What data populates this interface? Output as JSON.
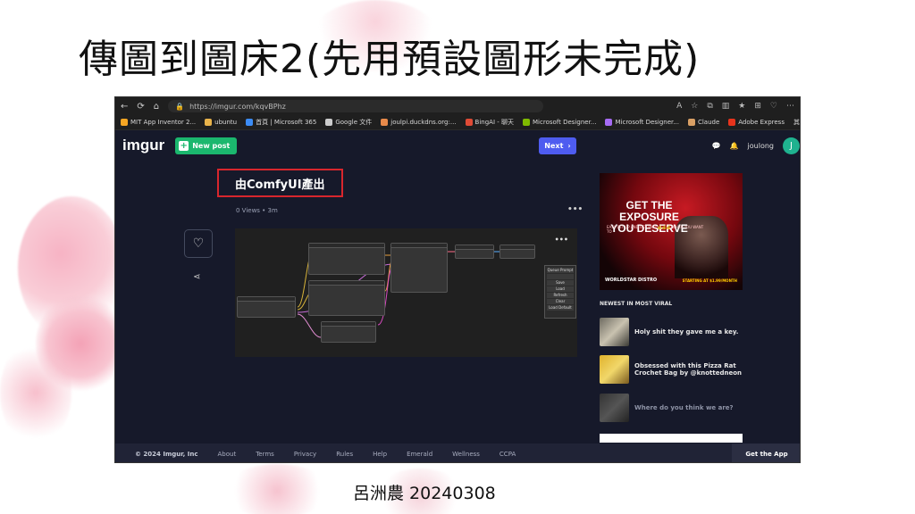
{
  "slide": {
    "title": "傳圖到圖床2(先用預設圖形未完成)",
    "author": "呂洲農 20240308"
  },
  "browser": {
    "url": "https://imgur.com/kqvBPhz",
    "bookmarks": [
      {
        "label": "MIT App Inventor 2...",
        "icon": "app-inventor-icon",
        "color": "#f6a623"
      },
      {
        "label": "ubuntu",
        "icon": "folder-icon",
        "color": "#e8b34b"
      },
      {
        "label": "首頁 | Microsoft 365",
        "icon": "microsoft365-icon",
        "color": "#3c8cf5"
      },
      {
        "label": "Google 文件",
        "icon": "document-icon",
        "color": "#cccccc"
      },
      {
        "label": "joulpi.duckdns.org:...",
        "icon": "site-icon",
        "color": "#e88a4a"
      },
      {
        "label": "BingAI - 聊天",
        "icon": "bing-icon",
        "color": "#e04b36"
      },
      {
        "label": "Microsoft Designer...",
        "icon": "microsoft-icon",
        "color": "#7fba00"
      },
      {
        "label": "Microsoft Designer...",
        "icon": "designer-icon",
        "color": "#a66bf4"
      },
      {
        "label": "Claude",
        "icon": "claude-icon",
        "color": "#d9a065"
      },
      {
        "label": "Adobe Express",
        "icon": "adobe-icon",
        "color": "#e8341c"
      }
    ],
    "bookmarks_overflow": "其他 [我的最"
  },
  "imgur": {
    "logo": "imgur",
    "new_post": "New post",
    "next": "Next",
    "username": "joulong",
    "avatar_letter": "J"
  },
  "post": {
    "title": "由ComfyUI產出",
    "meta": "0 Views • 3m",
    "comfy_menu": [
      "Queue Prompt",
      "",
      "Save",
      "Load",
      "Refresh",
      "Clear",
      "Load Default"
    ]
  },
  "sidebar": {
    "ad_headline": "GET THE EXPOSURE YOU DESERVE",
    "ad_sub": "EASY SET UP AND GET PAID 💰💰💰 WHEN YOU WANT TO",
    "ad_brand": "WORLDSTAR DISTRO",
    "ad_date": "STARTING AT $1.99/MONTH",
    "viral_heading": "NEWEST IN MOST VIRAL",
    "viral_items": [
      "Holy shit they gave me a key.",
      "Obsessed with this Pizza Rat Crochet Bag by @knottedneon",
      "Where do you think we are?"
    ]
  },
  "footer": {
    "copyright": "© 2024 Imgur, Inc",
    "links": [
      "About",
      "Terms",
      "Privacy",
      "Rules",
      "Help",
      "Emerald",
      "Wellness",
      "CCPA"
    ],
    "get_app": "Get the App"
  }
}
